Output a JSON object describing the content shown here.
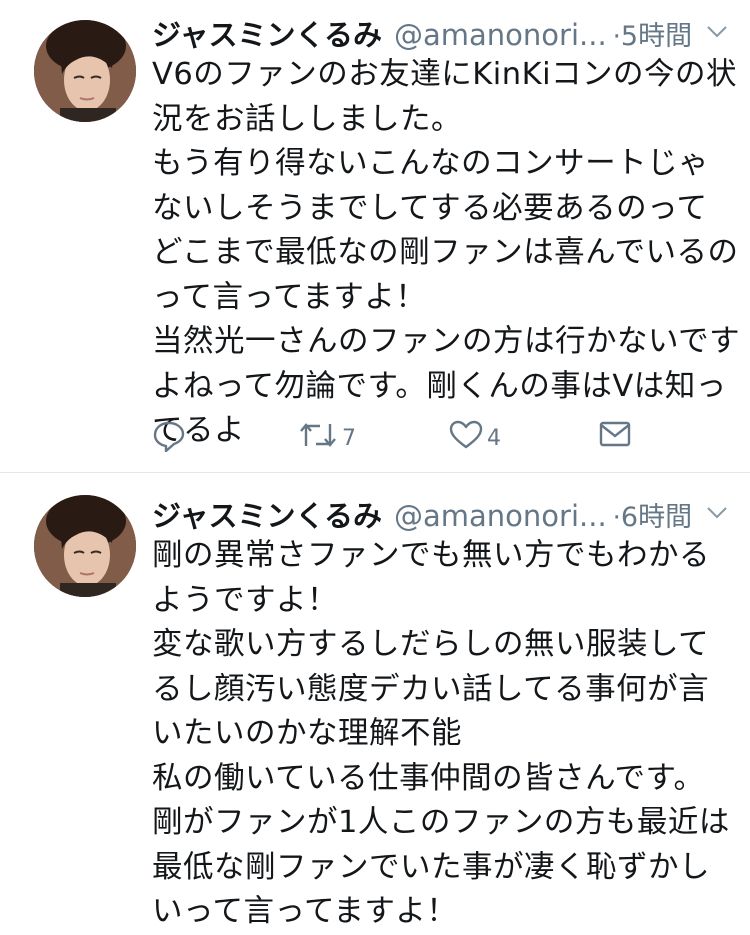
{
  "tweets": [
    {
      "display_name": "ジャスミンくるみ",
      "handle": "@amanonori...",
      "separator": "·",
      "time": "5時間",
      "lines": [
        "V6のファンのお友達にKinKiコンの今の状",
        "況をお話ししました。",
        "もう有り得ないこんなのコンサートじゃ",
        "ないしそうまでしてする必要あるのって",
        "どこまで最低なの剛ファンは喜んでいるの",
        "って言ってますよ！",
        "当然光一さんのファンの方は行かないです",
        "よねって勿論です。剛くんの事はVは知っ",
        "てるよ"
      ],
      "retweets": "7",
      "likes": "4"
    },
    {
      "display_name": "ジャスミンくるみ",
      "handle": "@amanonori...",
      "separator": "·",
      "time": "6時間",
      "lines": [
        "剛の異常さファンでも無い方でもわかる",
        "ようですよ！",
        "変な歌い方するしだらしの無い服装して",
        "るし顔汚い態度デカい話してる事何が言",
        "いたいのかな理解不能",
        "私の働いている仕事仲間の皆さんです。",
        "剛がファンが1人このファンの方も最近は",
        "最低な剛ファンでいた事が凄く恥ずかし",
        "いって言ってますよ！"
      ]
    }
  ],
  "icons": {
    "reply": "reply-icon",
    "retweet": "retweet-icon",
    "like": "heart-icon",
    "dm": "envelope-icon",
    "menu": "chevron-down-icon"
  },
  "colors": {
    "text": "#14171a",
    "secondary": "#657786",
    "divider": "#e1e8ed"
  }
}
